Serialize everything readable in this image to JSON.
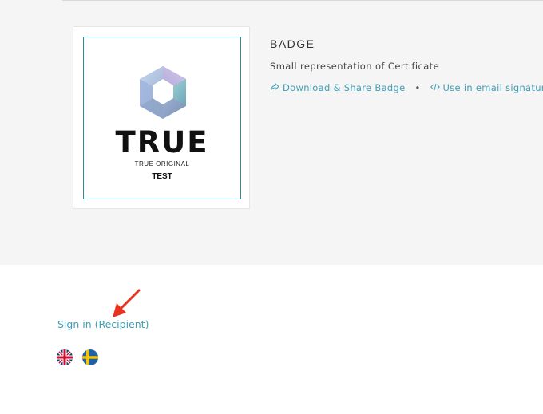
{
  "badge": {
    "title": "BADGE",
    "description": "Small representation of Certificate",
    "logo_word": "TRUE",
    "logo_subtitle": "TRUE ORIGINAL",
    "logo_tag": "TEST",
    "download_label": "Download & Share Badge",
    "separator": "•",
    "signature_label": "Use in email signature"
  },
  "footer": {
    "sign_in_label": "Sign in (Recipient)",
    "languages": [
      "English",
      "Swedish"
    ]
  },
  "colors": {
    "link": "#3f9fb5",
    "badge_border": "#2b8aa0",
    "arrow": "#e8321e",
    "panel_bg": "#f5f5f5"
  },
  "icons": [
    "share-icon",
    "code-icon",
    "uk-flag-icon",
    "sweden-flag-icon",
    "red-arrow-icon"
  ]
}
